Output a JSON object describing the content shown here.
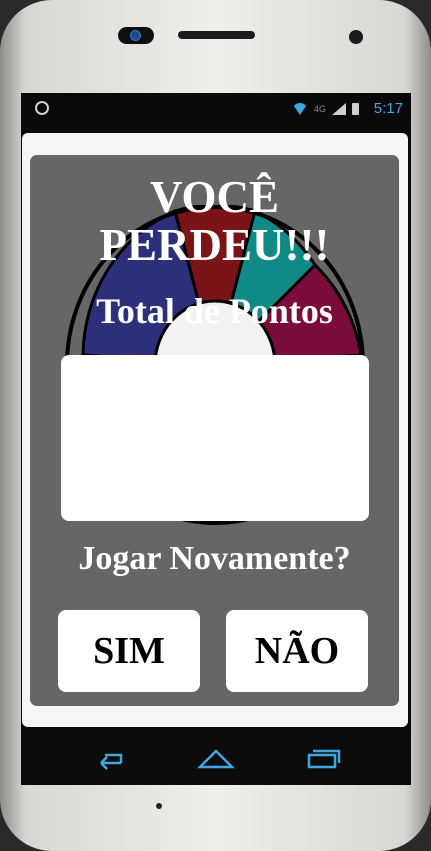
{
  "status_bar": {
    "time": "5:17",
    "network_type": "4G"
  },
  "dialog": {
    "title": "VOCÊ PERDEU!!!",
    "subtitle": "Total de Pontos",
    "score_value": "",
    "question": "Jogar Novamente?",
    "yes_label": "SIM",
    "no_label": "NÃO"
  },
  "wheel_colors": [
    "#2c2f7a",
    "#7a1416",
    "#0f8a86",
    "#7a0d3b"
  ],
  "colors": {
    "dialog_background": "#666666",
    "clock": "#3fa7e0"
  },
  "icons": [
    "motorola-icon",
    "wifi-icon",
    "signal-icon",
    "battery-icon",
    "back-icon",
    "home-icon",
    "recent-apps-icon",
    "camera-icon"
  ]
}
